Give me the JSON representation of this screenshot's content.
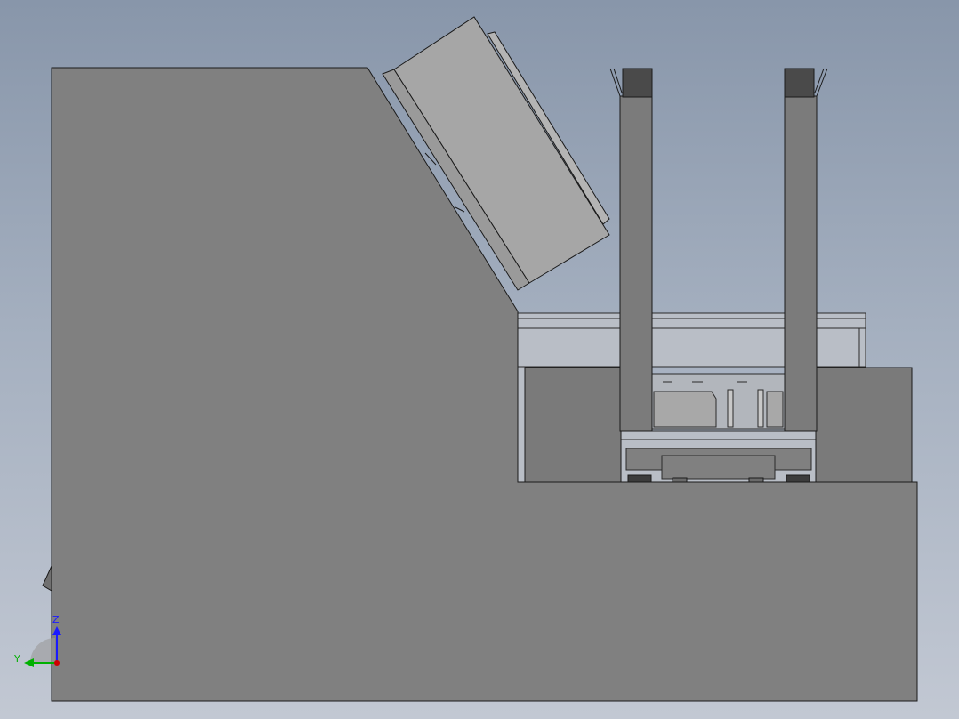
{
  "viewport": {
    "background_top": "#8896aa",
    "background_bottom": "#c2c8d3"
  },
  "colors": {
    "body_fill": "#808080",
    "edge": "#1a1a1a",
    "light_part": "#a6a6a6",
    "dark_cap": "#4a4a4a",
    "frame_fill": "#b8bcc2"
  },
  "triad": {
    "z_label": "Z",
    "y_label": "Y",
    "z_color": "#1a1aff",
    "y_color": "#00b000",
    "x_color": "#d00000"
  }
}
